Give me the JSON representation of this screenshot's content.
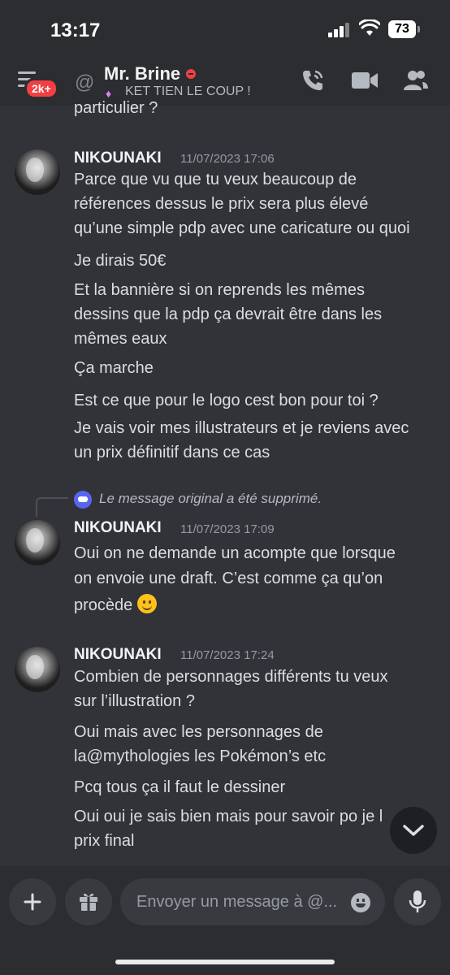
{
  "status_bar": {
    "time": "13:17",
    "battery": "73"
  },
  "header": {
    "unread_badge": "2k+",
    "user_name": "Mr. Brine",
    "user_status": "KET TIEN LE COUP !",
    "icons": [
      "hamburger-menu-icon",
      "at-icon",
      "phone-call-icon",
      "video-camera-icon",
      "members-icon"
    ]
  },
  "messages": {
    "partial_line": "particulier ?",
    "groups": [
      {
        "author": "NIKOUNAKI",
        "timestamp": "11/07/2023 17:06",
        "lines": [
          "Parce que vu que tu veux beaucoup de",
          "références dessus le prix sera plus élevé",
          "qu’une simple pdp avec une caricature ou quoi",
          "Je dirais 50€",
          "Et la bannière si on reprends les mêmes",
          "dessins que la pdp ça devrait être dans les",
          "mêmes eaux",
          "Ça marche",
          "Est ce que pour le logo cest bon pour toi ?",
          "Je vais voir mes illustrateurs et je reviens avec",
          "un prix définitif dans ce cas"
        ]
      },
      {
        "reply_note": "Le message original a été supprimé.",
        "author": "NIKOUNAKI",
        "timestamp": "11/07/2023 17:09",
        "lines": [
          "Oui on ne demande un acompte que lorsque",
          "on envoie une draft. C’est comme ça qu’on",
          "procède"
        ]
      },
      {
        "author": "NIKOUNAKI",
        "timestamp": "11/07/2023 17:24",
        "lines": [
          "Combien de personnages différents tu veux",
          "sur l’illustration ?",
          "Oui mais avec les personnages de",
          "la@mythologies les Pokémon’s etc",
          "Pcq tous ça il faut le dessiner",
          "Oui oui je sais bien mais pour savoir po je l",
          "prix final"
        ]
      }
    ]
  },
  "composer": {
    "placeholder": "Envoyer un message à @...",
    "icons": [
      "plus-icon",
      "gift-icon",
      "emoji-icon",
      "microphone-icon"
    ]
  },
  "colors": {
    "background": "#313338",
    "header": "#2b2d31",
    "badge": "#f23f43",
    "blurple": "#5865f2"
  }
}
